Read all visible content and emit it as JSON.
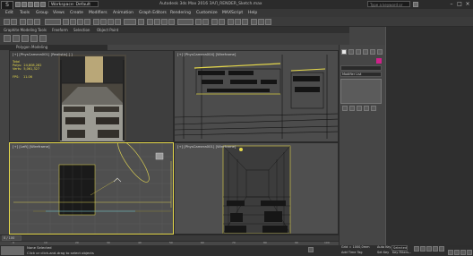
{
  "titlebar": {
    "workspace": "Workspace: Default",
    "title": "Autodesk 3ds Max 2016   ЗАЛ_RENDER_Sketch.max",
    "search_placeholder": "Type a keyword or phrase",
    "logo": "S",
    "minimize": "–",
    "maximize": "□",
    "close": "×"
  },
  "menu": [
    "Edit",
    "Tools",
    "Group",
    "Views",
    "Create",
    "Modifiers",
    "Animation",
    "Graph Editors",
    "Rendering",
    "Customize",
    "MAXScript",
    "Help"
  ],
  "ribbon": {
    "tabs": [
      "Graphite Modeling Tools",
      "Freeform",
      "Selection",
      "Object Paint"
    ],
    "subtab": "Polygon Modeling"
  },
  "viewports": {
    "top_left": {
      "label": "[+] [PhysCamera001] [Realistic] [ ]",
      "stats": "Total\nPolys:  24,808,282\nVerts:  5,061,327\n\nFPS:    11.06"
    },
    "top_right": {
      "label": "[+] [PhysCamera004] [Wireframe]"
    },
    "bottom_left": {
      "label": "[+] [Left] [Wireframe]"
    },
    "bottom_right": {
      "label": "[+] [PhysCamera001] [Wireframe]"
    }
  },
  "command_panel": {
    "modifier_list": "Modifier List",
    "accent_color": "#d0218a"
  },
  "timeslider": {
    "position": "0 / 100",
    "ticks": [
      "0",
      "10",
      "20",
      "30",
      "40",
      "50",
      "60",
      "70",
      "80",
      "90",
      "100"
    ]
  },
  "statusbar": {
    "selection": "None Selected",
    "prompt": "Click or click-and-drag to select objects",
    "grid": "Grid = 1000,0mm",
    "add_time_tag": "Add Time Tag",
    "auto_key": "Auto Key",
    "selected": "Selected",
    "set_key": "Set Key",
    "key_filters": "Key Filters..."
  },
  "colors": {
    "selection_yellow": "#e5d84b",
    "viewport_bg": "#505050"
  }
}
